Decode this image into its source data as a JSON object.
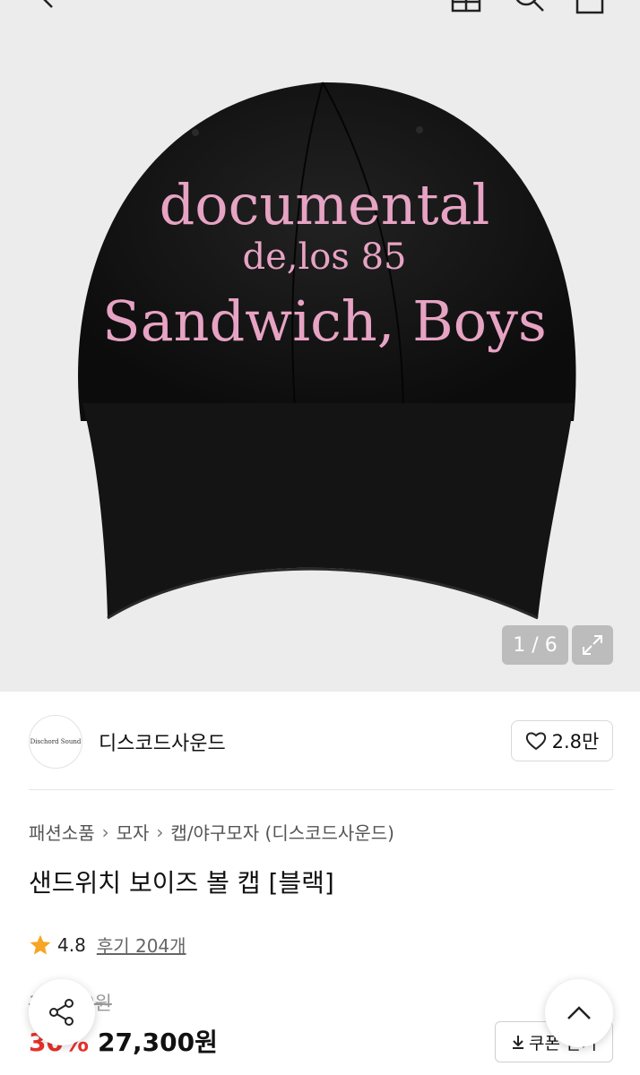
{
  "gallery": {
    "counter": "1 / 6",
    "cap_text": [
      "documental",
      "de,los 85",
      "Sandwich, Boys"
    ]
  },
  "seller": {
    "avatar_text": "Dischord Sound",
    "name": "디스코드사운드",
    "likes": "2.8만"
  },
  "breadcrumb": [
    "패션소품",
    "모자",
    "캡/야구모자 (디스코드사운드)"
  ],
  "product": {
    "title": "샌드위치 보이즈 볼 캡 [블랙]",
    "rating": "4.8",
    "reviews": "후기 204개",
    "original_price": "39,000원",
    "discount": "30%",
    "price": "27,300원"
  },
  "buttons": {
    "coupon": "쿠폰 받기"
  },
  "colors": {
    "discount": "#e8302a",
    "star": "#f5a623",
    "embroidery": "#e7a3c3"
  }
}
